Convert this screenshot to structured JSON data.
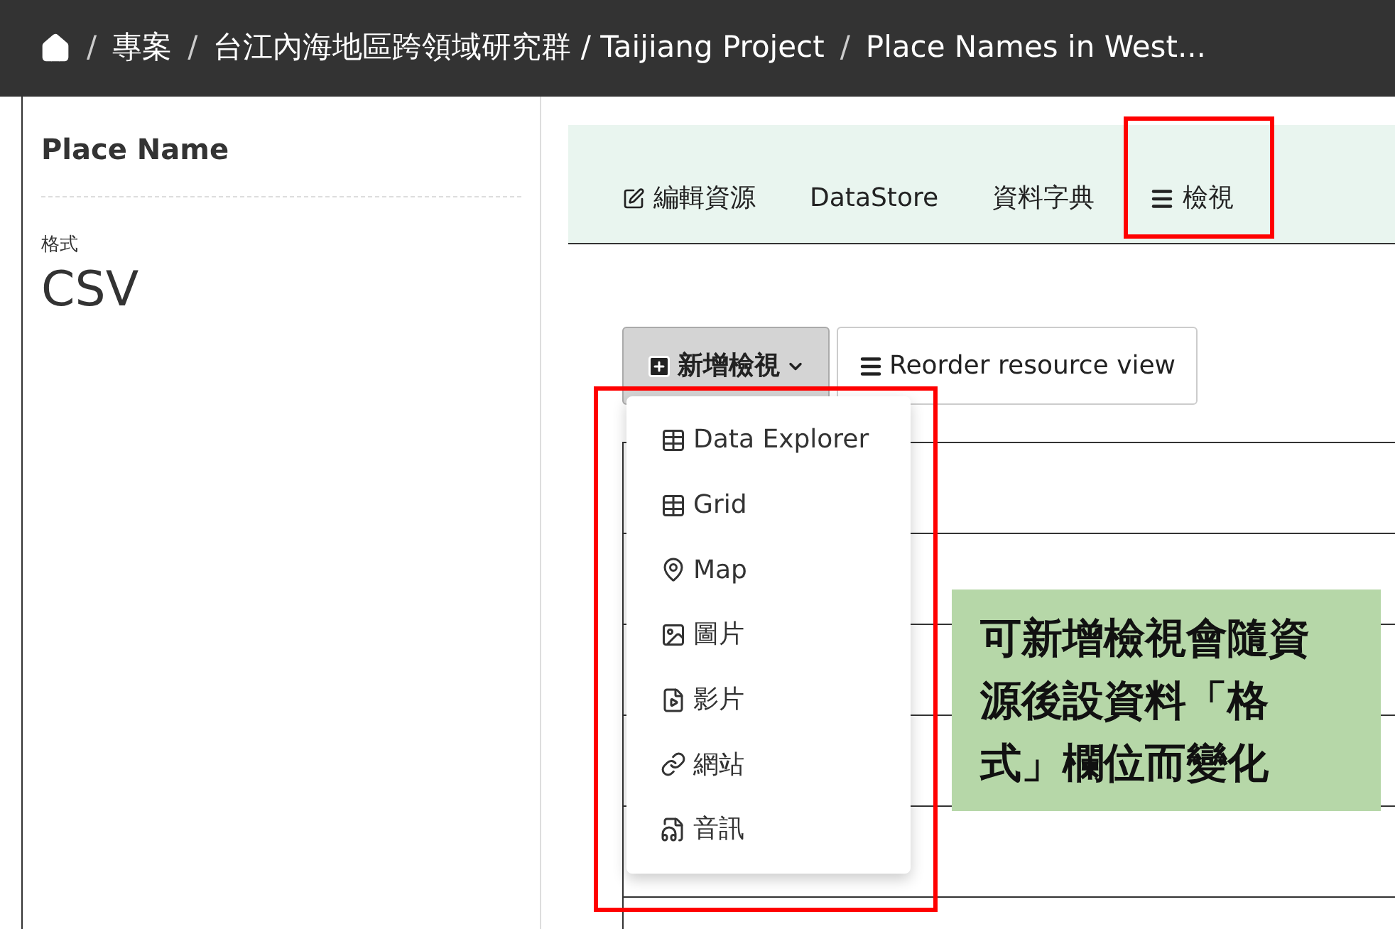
{
  "breadcrumb": [
    {
      "kind": "home"
    },
    {
      "kind": "separator",
      "label": "/"
    },
    {
      "kind": "text",
      "label": "專案"
    },
    {
      "kind": "separator",
      "label": "/"
    },
    {
      "kind": "text",
      "label": "台江內海地區跨領域研究群 / Taijiang Project"
    },
    {
      "kind": "separator",
      "label": "/"
    },
    {
      "kind": "text",
      "label": "Place Names in West..."
    }
  ],
  "sidebar": {
    "title": "Place Name",
    "field_label": "格式",
    "field_value": "CSV"
  },
  "tabs": [
    {
      "kind": "edit",
      "label": "編輯資源",
      "highlighted": false
    },
    {
      "kind": "plain",
      "label": "DataStore",
      "highlighted": false
    },
    {
      "kind": "plain",
      "label": "資料字典",
      "highlighted": false
    },
    {
      "kind": "menu",
      "label": "檢視",
      "highlighted": true
    }
  ],
  "add_view_button": {
    "label": "新增檢視",
    "expanded": true
  },
  "reorder_button": {
    "label": "Reorder resource view"
  },
  "view_menu": {
    "highlighted": true,
    "items": [
      {
        "kind": "table",
        "label": "Data Explorer"
      },
      {
        "kind": "table",
        "label": "Grid"
      },
      {
        "kind": "map",
        "label": "Map"
      },
      {
        "kind": "image",
        "label": "圖片"
      },
      {
        "kind": "video",
        "label": "影片"
      },
      {
        "kind": "link",
        "label": "網站"
      },
      {
        "kind": "audio",
        "label": "音訊"
      }
    ]
  },
  "note": "可新增檢視會隨資源後設資料「格式」欄位而變化"
}
